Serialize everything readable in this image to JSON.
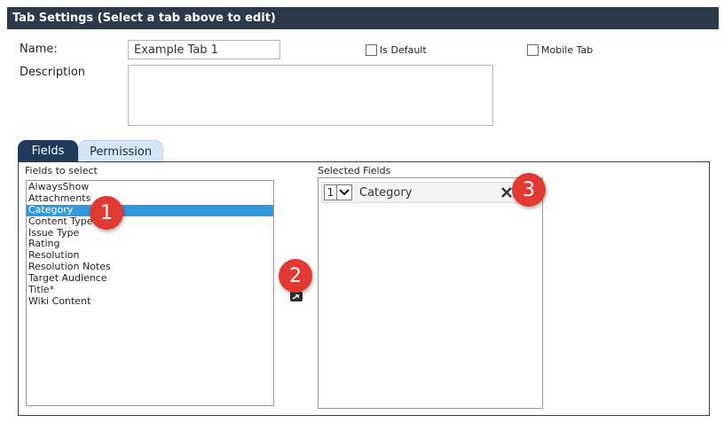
{
  "header": {
    "title": "Tab Settings (Select a tab above to edit)"
  },
  "form": {
    "name_label": "Name:",
    "name_value": "Example Tab 1",
    "description_label": "Description",
    "is_default_label": "Is Default",
    "mobile_tab_label": "Mobile Tab"
  },
  "tabs": [
    {
      "label": "Fields",
      "active": true
    },
    {
      "label": "Permission",
      "active": false
    }
  ],
  "fields_panel": {
    "fields_to_select_label": "Fields to select",
    "selected_fields_label": "Selected Fields",
    "available_fields": [
      "AlwaysShow",
      "Attachments",
      "Category",
      "Content Type",
      "Issue Type",
      "Rating",
      "Resolution",
      "Resolution Notes",
      "Target Audience",
      "Title*",
      "Wiki Content"
    ],
    "selected_index": 2,
    "selected_fields": [
      {
        "order": "1",
        "name": "Category"
      }
    ]
  },
  "callouts": [
    "1",
    "2",
    "3"
  ],
  "colors": {
    "header_bg": "#2b3a4a",
    "active_tab": "#1f3a5a",
    "inactive_tab": "#d5e6f8",
    "selection": "#3399dd",
    "callout": "#e03a33"
  },
  "icons": {
    "remove": "close-icon",
    "move": "move-right-icon",
    "dropdown": "chevron-down-icon"
  }
}
